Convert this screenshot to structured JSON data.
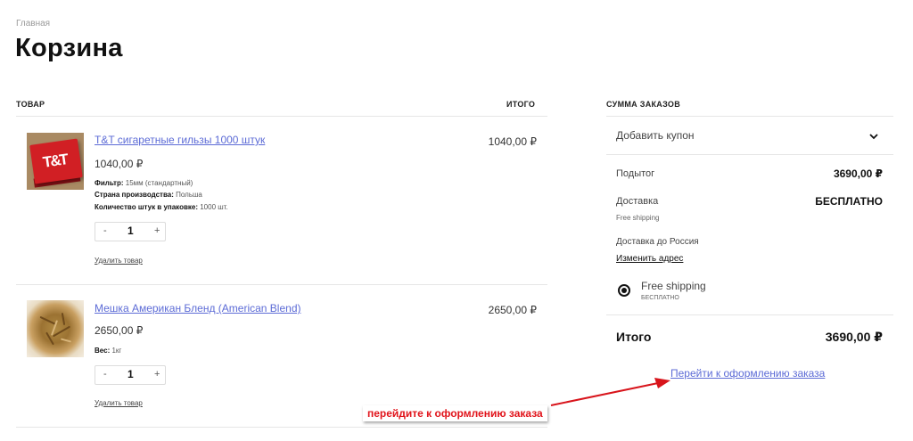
{
  "breadcrumb": "Главная",
  "page_title": "Корзина",
  "cart": {
    "col_product": "ТОВАР",
    "col_total": "ИТОГО",
    "items": [
      {
        "name": "T&T сигаретные гильзы 1000 штук",
        "price": "1040,00 ₽",
        "attributes": [
          {
            "label": "Фильтр:",
            "value": "15мм (стандартный)"
          },
          {
            "label": "Страна производства:",
            "value": "Польша"
          },
          {
            "label": "Количество штук в упаковке:",
            "value": "1000 шт."
          }
        ],
        "quantity": "1",
        "minus": "-",
        "plus": "+",
        "remove": "Удалить товар",
        "total": "1040,00 ₽",
        "thumb_text": "T&T"
      },
      {
        "name": "Мешка Американ Бленд (American Blend)",
        "price": "2650,00 ₽",
        "attributes": [
          {
            "label": "Вес:",
            "value": "1кг"
          }
        ],
        "quantity": "1",
        "minus": "-",
        "plus": "+",
        "remove": "Удалить товар",
        "total": "2650,00 ₽"
      }
    ]
  },
  "summary": {
    "heading": "СУММА ЗАКАЗОВ",
    "coupon_label": "Добавить купон",
    "subtotal_label": "Подытог",
    "subtotal_value": "3690,00 ₽",
    "shipping_label": "Доставка",
    "shipping_value": "БЕСПЛАТНО",
    "shipping_method": "Free shipping",
    "shipping_to": "Доставка до Россия",
    "change_address": "Изменить адрес",
    "option_name": "Free shipping",
    "option_price": "БЕСПЛАТНО",
    "total_label": "Итого",
    "total_value": "3690,00 ₽",
    "checkout": "Перейти к оформлению заказа"
  },
  "annotation": {
    "text": "перейдите к оформлению заказа",
    "color": "#e1141b"
  },
  "colors": {
    "link": "#5c6bd6",
    "divider": "#e6e6e6"
  },
  "icons": {
    "coupon_toggle": "chevron-down-icon",
    "annotation_pointer": "arrow-icon"
  }
}
